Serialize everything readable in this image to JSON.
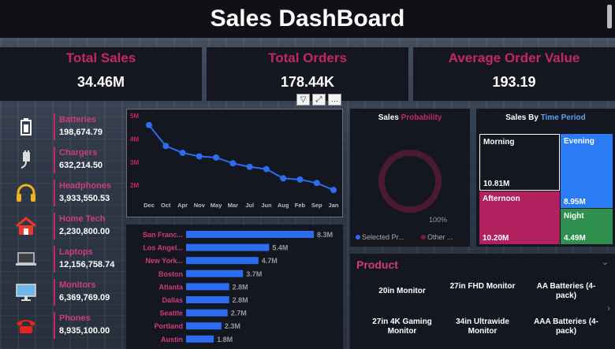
{
  "title": "Sales DashBoard",
  "kpis": [
    {
      "label": "Total Sales",
      "value": "34.46M"
    },
    {
      "label": "Total Orders",
      "value": "178.44K"
    },
    {
      "label": "Average Order Value",
      "value": "193.19"
    }
  ],
  "categories": [
    {
      "name": "Batteries",
      "value": "198,674.79",
      "icon": "battery-icon"
    },
    {
      "name": "Chargers",
      "value": "632,214.50",
      "icon": "charger-icon"
    },
    {
      "name": "Headphones",
      "value": "3,933,550.53",
      "icon": "headphones-icon"
    },
    {
      "name": "Home Tech",
      "value": "2,230,800.00",
      "icon": "home-icon"
    },
    {
      "name": "Laptops",
      "value": "12,156,758.74",
      "icon": "laptop-icon"
    },
    {
      "name": "Monitors",
      "value": "6,369,769.09",
      "icon": "monitor-icon"
    },
    {
      "name": "Phones",
      "value": "8,935,100.00",
      "icon": "phone-icon"
    }
  ],
  "line_chart": {
    "yticks": [
      "5M",
      "4M",
      "3M",
      "2M"
    ]
  },
  "sales_probability": {
    "title_a": "Sales ",
    "title_b": "Probability",
    "pct": "100%",
    "legend": [
      "Selected Pr...",
      "Other ..."
    ]
  },
  "time_period": {
    "title_a": "Sales By ",
    "title_b": "Time Period",
    "cells": [
      {
        "name": "Morning",
        "value": "10.81M",
        "color": "#14171f"
      },
      {
        "name": "Evening",
        "value": "8.95M",
        "color": "#2b7bf5"
      },
      {
        "name": "Afternoon",
        "value": "10.20M",
        "color": "#b1205f"
      },
      {
        "name": "Night",
        "value": "4.49M",
        "color": "#2f8f4e"
      }
    ]
  },
  "product": {
    "title": "Product",
    "items": [
      "20in Monitor",
      "27in FHD Monitor",
      "AA Batteries (4-pack)",
      "27in 4K Gaming Monitor",
      "34in Ultrawide Monitor",
      "AAA Batteries (4-pack)"
    ]
  },
  "colors": {
    "accent": "#c4256b",
    "bar": "#2b6cf0"
  },
  "chart_data": [
    {
      "type": "line",
      "x": [
        "Dec",
        "Oct",
        "Apr",
        "Nov",
        "May",
        "Mar",
        "Jul",
        "Jun",
        "Aug",
        "Feb",
        "Sep",
        "Jan"
      ],
      "values": [
        4.6,
        3.7,
        3.4,
        3.25,
        3.2,
        2.95,
        2.8,
        2.7,
        2.3,
        2.25,
        2.1,
        1.8
      ],
      "ylim": [
        1.6,
        5.0
      ],
      "yticks": [
        "5M",
        "4M",
        "3M",
        "2M"
      ],
      "grid": false
    },
    {
      "type": "bar",
      "orientation": "horizontal",
      "categories": [
        "San Franc...",
        "Los Angel...",
        "New York...",
        "Boston",
        "Atlanta",
        "Dallas",
        "Seattle",
        "Portland",
        "Austin"
      ],
      "values": [
        8.3,
        5.4,
        4.7,
        3.7,
        2.8,
        2.8,
        2.7,
        2.3,
        1.8
      ],
      "labels": [
        "8.3M",
        "5.4M",
        "4.7M",
        "3.7M",
        "2.8M",
        "2.8M",
        "2.7M",
        "2.3M",
        "1.8M"
      ]
    },
    {
      "type": "pie",
      "style": "donut",
      "values": [
        100,
        0
      ],
      "labels": [
        "Selected Pr...",
        "Other ..."
      ]
    }
  ]
}
